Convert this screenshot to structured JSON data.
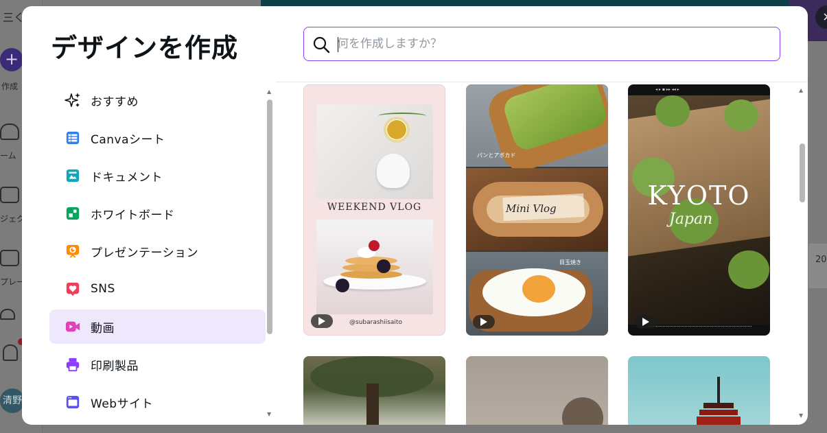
{
  "modal": {
    "title": "デザインを作成",
    "search": {
      "placeholder": "何を作成しますか？"
    }
  },
  "sidebar": {
    "items": [
      {
        "label": "おすすめ",
        "icon": "sparkles-icon",
        "color": "#0e1318"
      },
      {
        "label": "Canvaシート",
        "icon": "sheet-icon",
        "color": "#2f80ed"
      },
      {
        "label": "ドキュメント",
        "icon": "document-icon",
        "color": "#13a8b8"
      },
      {
        "label": "ホワイトボード",
        "icon": "whiteboard-icon",
        "color": "#0ba360"
      },
      {
        "label": "プレゼンテーション",
        "icon": "presentation-icon",
        "color": "#ff8a00"
      },
      {
        "label": "SNS",
        "icon": "heart-icon",
        "color": "#f23c5a"
      },
      {
        "label": "動画",
        "icon": "video-icon",
        "color": "#e040b8",
        "active": true
      },
      {
        "label": "印刷製品",
        "icon": "print-icon",
        "color": "#8b3dff"
      },
      {
        "label": "Webサイト",
        "icon": "website-icon",
        "color": "#5b4ff0"
      }
    ]
  },
  "templates": [
    {
      "title": "WEEKEND VLOG",
      "handle": "@subarashiisaito",
      "has_play": true
    },
    {
      "title": "Mini Vlog",
      "caption_top": "パンとアボカド",
      "caption_bottom": "目玉焼き",
      "has_play": true
    },
    {
      "title": "KYOTO",
      "subtitle": "Japan",
      "has_play": true
    },
    {
      "title": ""
    },
    {
      "title": ""
    },
    {
      "title": ""
    }
  ],
  "background": {
    "rail_labels": [
      "作成",
      "ホーム",
      "プロジェクト",
      "テンプレート"
    ],
    "avatar_text": "清野",
    "right_panel_text": "20",
    "menu_glyph": "三く",
    "close_glyph": "×"
  },
  "colors": {
    "accent": "#8b3dff",
    "active_bg": "#efe8fd"
  }
}
